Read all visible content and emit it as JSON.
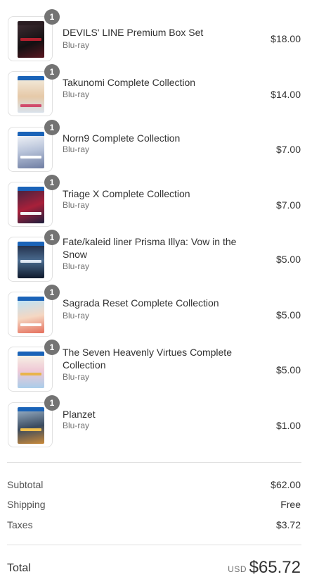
{
  "items": [
    {
      "quantity": "1",
      "title": "DEVILS' LINE Premium Box Set",
      "variant": "Blu-ray",
      "price": "$18.00"
    },
    {
      "quantity": "1",
      "title": "Takunomi Complete Collection",
      "variant": "Blu-ray",
      "price": "$14.00"
    },
    {
      "quantity": "1",
      "title": "Norn9 Complete Collection",
      "variant": "Blu-ray",
      "price": "$7.00"
    },
    {
      "quantity": "1",
      "title": "Triage X Complete Collection",
      "variant": "Blu-ray",
      "price": "$7.00"
    },
    {
      "quantity": "1",
      "title": "Fate/kaleid liner Prisma Illya: Vow in the Snow",
      "variant": "Blu-ray",
      "price": "$5.00"
    },
    {
      "quantity": "1",
      "title": "Sagrada Reset Complete Collection",
      "variant": "Blu-ray",
      "price": "$5.00"
    },
    {
      "quantity": "1",
      "title": "The Seven Heavenly Virtues Complete Collection",
      "variant": "Blu-ray",
      "price": "$5.00"
    },
    {
      "quantity": "1",
      "title": "Planzet",
      "variant": "Blu-ray",
      "price": "$1.00"
    }
  ],
  "summary": {
    "subtotal_label": "Subtotal",
    "subtotal_value": "$62.00",
    "shipping_label": "Shipping",
    "shipping_value": "Free",
    "taxes_label": "Taxes",
    "taxes_value": "$3.72"
  },
  "total": {
    "label": "Total",
    "currency": "USD",
    "amount": "$65.72"
  },
  "colors": {
    "badge": "#737373",
    "border": "#e1e1e1",
    "text": "#323232",
    "muted": "#737373"
  }
}
